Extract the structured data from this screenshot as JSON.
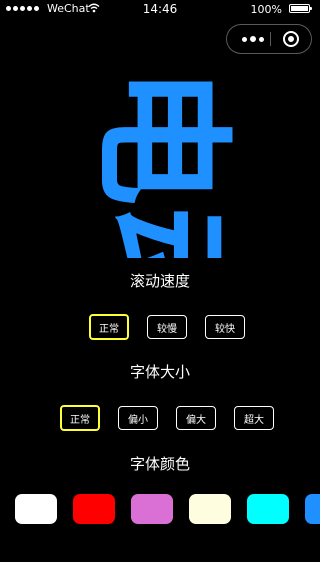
{
  "status_bar": {
    "carrier": "WeChat",
    "time": "14:46",
    "battery": "100%",
    "battery_level": 1.0
  },
  "marquee": {
    "text": "电动",
    "color": "#1e90ff"
  },
  "scroll_speed": {
    "title": "滚动速度",
    "options": [
      "正常",
      "较慢",
      "较快"
    ],
    "selected": "正常"
  },
  "font_size": {
    "title": "字体大小",
    "options": [
      "正常",
      "偏小",
      "偏大",
      "超大"
    ],
    "selected": "正常"
  },
  "font_color": {
    "title": "字体颜色",
    "colors": [
      "#ffffff",
      "#ff0000",
      "#da70d6",
      "#fffde0",
      "#00ffff",
      "#1e90ff"
    ]
  },
  "accent": {
    "selected_border": "#ffff33"
  }
}
